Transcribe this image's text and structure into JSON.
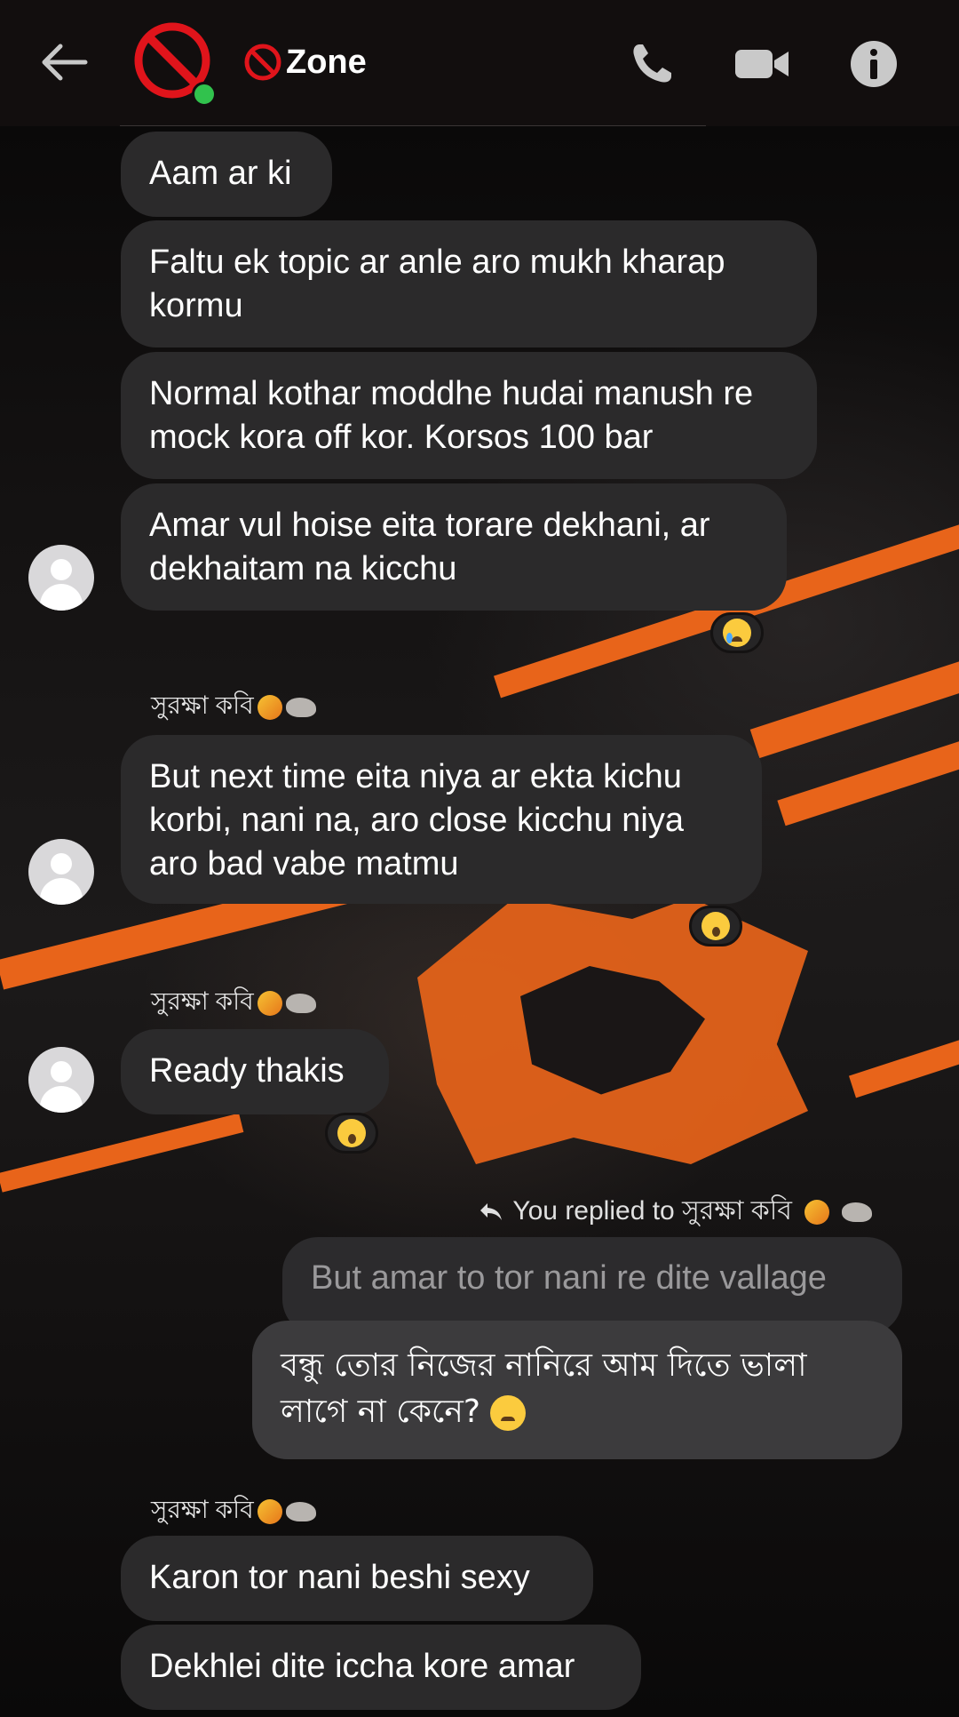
{
  "header": {
    "title": "Zone",
    "icons": [
      "back-arrow-icon",
      "no-entry-icon",
      "phone-icon",
      "video-icon",
      "info-icon"
    ]
  },
  "colors": {
    "accent": "#e8641a",
    "bubble_other": "#2b2a2b",
    "bubble_mine": "#3c3b3d",
    "online": "#31c24d"
  },
  "messages": [
    {
      "text": "Aam ar ki"
    },
    {
      "text": "Faltu ek topic ar anle aro mukh kharap kormu"
    },
    {
      "text": "Normal kothar moddhe hudai manush re mock kora off kor. Korsos 100 bar"
    },
    {
      "text": "Amar vul hoise eita torare dekhani, ar dekhaitam na kicchu"
    },
    {
      "text": "But next time eita niya ar ekta kichu korbi, nani na, aro close kicchu niya aro bad vabe matmu"
    },
    {
      "text": "Ready thakis"
    },
    {
      "text": "Karon tor nani beshi sexy"
    },
    {
      "text": "Dekhlei dite iccha kore amar"
    }
  ],
  "sender_name": "সুরক্ষা কবি",
  "reply": {
    "hint": "You replied to সুরক্ষা কবি",
    "quoted": "But amar to tor nani re dite vallage",
    "text": "বন্ধু তোর নিজের নানিরে আম দিতে ভালা লাগে না কেনে?"
  },
  "reactions": [
    "crying-face",
    "surprised-face",
    "surprised-face"
  ]
}
